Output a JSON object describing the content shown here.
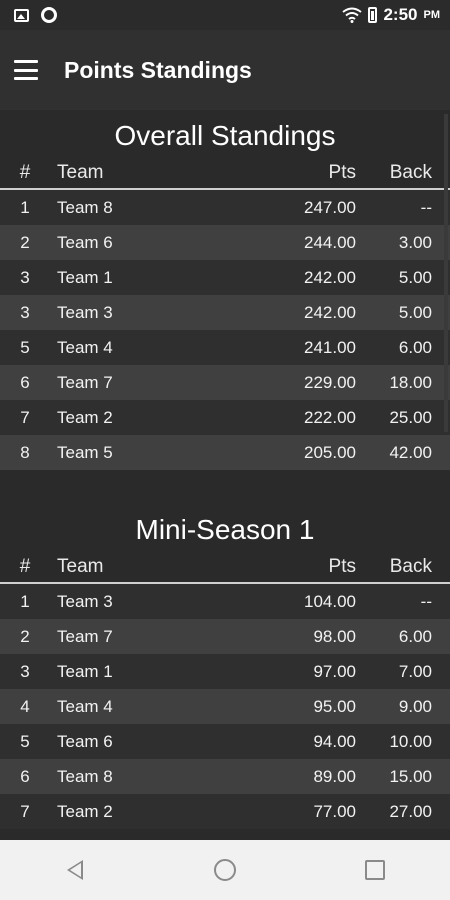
{
  "status_bar": {
    "time": "2:50",
    "time_suffix": "PM"
  },
  "app_bar": {
    "title": "Points Standings"
  },
  "columns": {
    "rank": "#",
    "team": "Team",
    "pts": "Pts",
    "back": "Back"
  },
  "overall": {
    "title": "Overall Standings",
    "rows": [
      {
        "rank": "1",
        "team": "Team 8",
        "pts": "247.00",
        "back": "--"
      },
      {
        "rank": "2",
        "team": "Team 6",
        "pts": "244.00",
        "back": "3.00"
      },
      {
        "rank": "3",
        "team": "Team 1",
        "pts": "242.00",
        "back": "5.00"
      },
      {
        "rank": "3",
        "team": "Team 3",
        "pts": "242.00",
        "back": "5.00"
      },
      {
        "rank": "5",
        "team": "Team 4",
        "pts": "241.00",
        "back": "6.00"
      },
      {
        "rank": "6",
        "team": "Team 7",
        "pts": "229.00",
        "back": "18.00"
      },
      {
        "rank": "7",
        "team": "Team 2",
        "pts": "222.00",
        "back": "25.00"
      },
      {
        "rank": "8",
        "team": "Team 5",
        "pts": "205.00",
        "back": "42.00"
      }
    ]
  },
  "mini_season": {
    "title": "Mini-Season 1",
    "rows": [
      {
        "rank": "1",
        "team": "Team 3",
        "pts": "104.00",
        "back": "--"
      },
      {
        "rank": "2",
        "team": "Team 7",
        "pts": "98.00",
        "back": "6.00"
      },
      {
        "rank": "3",
        "team": "Team 1",
        "pts": "97.00",
        "back": "7.00"
      },
      {
        "rank": "4",
        "team": "Team 4",
        "pts": "95.00",
        "back": "9.00"
      },
      {
        "rank": "5",
        "team": "Team 6",
        "pts": "94.00",
        "back": "10.00"
      },
      {
        "rank": "6",
        "team": "Team 8",
        "pts": "89.00",
        "back": "15.00"
      },
      {
        "rank": "7",
        "team": "Team 2",
        "pts": "77.00",
        "back": "27.00"
      }
    ]
  }
}
